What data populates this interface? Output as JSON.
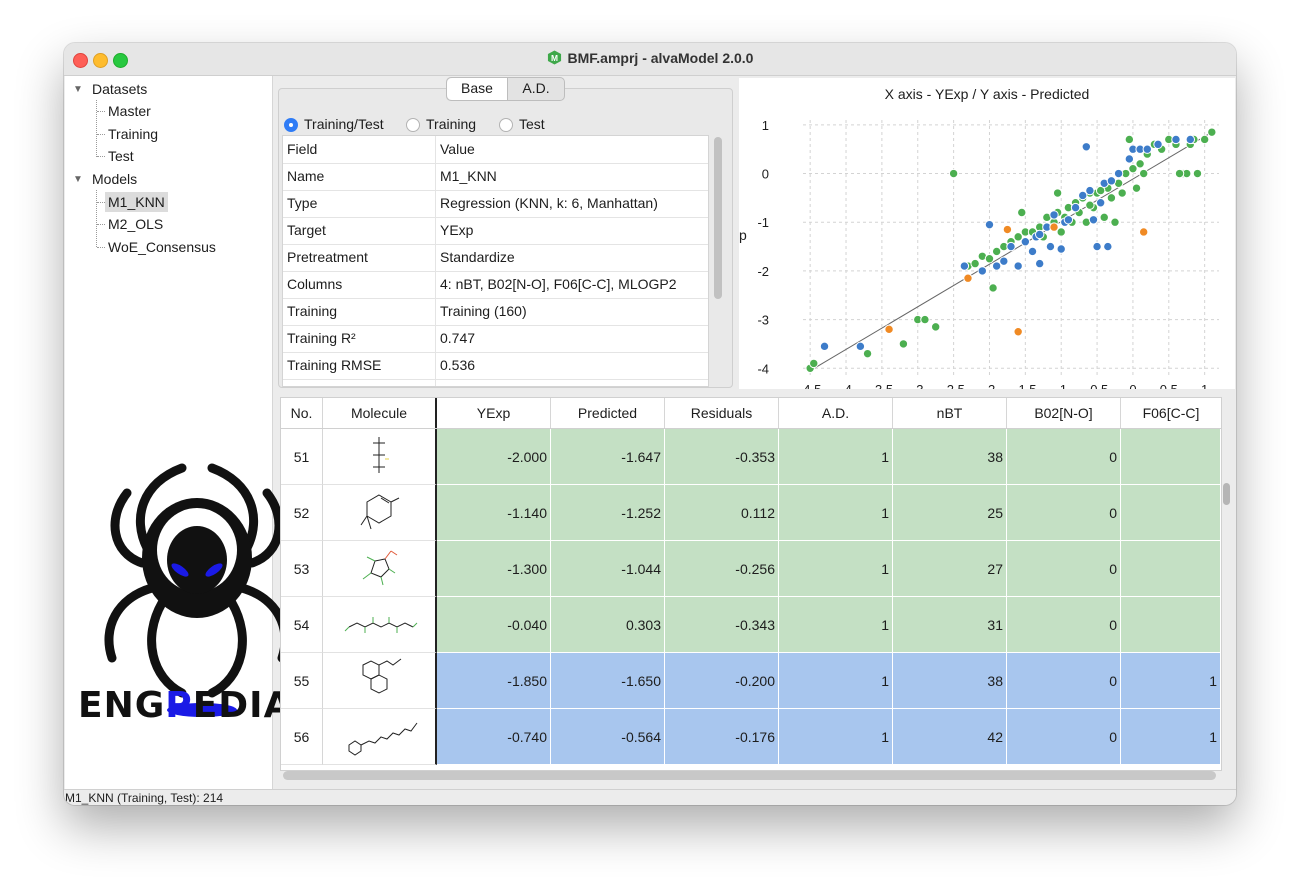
{
  "window": {
    "title": "BMF.amprj - alvaModel 2.0.0",
    "app_icon_letter": "M"
  },
  "tree": {
    "datasets": {
      "label": "Datasets",
      "children": [
        "Master",
        "Training",
        "Test"
      ]
    },
    "models": {
      "label": "Models",
      "children": [
        "M1_KNN",
        "M2_OLS",
        "WoE_Consensus"
      ],
      "selected": "M1_KNN"
    }
  },
  "logo": {
    "text": "ENGPEDIA.IR"
  },
  "tabs": {
    "base": "Base",
    "ad": "A.D.",
    "active": "Base"
  },
  "radios": {
    "training_test": "Training/Test",
    "training": "Training",
    "test": "Test",
    "selected": "Training/Test"
  },
  "properties": {
    "header": {
      "field": "Field",
      "value": "Value"
    },
    "rows": [
      {
        "field": "Name",
        "value": "M1_KNN"
      },
      {
        "field": "Type",
        "value": "Regression (KNN, k: 6, Manhattan)"
      },
      {
        "field": "Target",
        "value": "YExp"
      },
      {
        "field": "Pretreatment",
        "value": "Standardize"
      },
      {
        "field": "Columns",
        "value": "4: nBT, B02[N-O], F06[C-C], MLOGP2"
      },
      {
        "field": "Training",
        "value": "Training (160)"
      },
      {
        "field": "Training R²",
        "value": "0.747"
      },
      {
        "field": "Training RMSE",
        "value": "0.536"
      }
    ]
  },
  "chart_data": {
    "type": "scatter",
    "title": "X axis - YExp / Y axis - Predicted",
    "ylabel_partial": "p",
    "xlim": [
      -4.6,
      1.2
    ],
    "ylim": [
      -4.2,
      1.1
    ],
    "xticks": [
      -4.5,
      -4,
      -3.5,
      -3,
      -2.5,
      -2,
      -1.5,
      -1,
      -0.5,
      0,
      0.5,
      1
    ],
    "xtick_labels": [
      "-4.5",
      "-4",
      "-3.5",
      "-3",
      "-2.5",
      "-2",
      "-1.5",
      "-1",
      "-0.5",
      "0",
      "0.5",
      "1"
    ],
    "yticks": [
      1,
      0,
      -1,
      -2,
      -3,
      -4
    ],
    "ytick_labels": [
      "1-",
      "0-",
      "-1-",
      "-2-",
      "-3-",
      "-4-"
    ],
    "grid": true,
    "colors": {
      "green": "#4caf50",
      "blue": "#3d7cc9",
      "orange": "#f08a24",
      "line": "#666666"
    },
    "fit_line": {
      "x": [
        -4.5,
        1.1
      ],
      "y": [
        -4.05,
        0.85
      ]
    },
    "series": [
      {
        "color": "green",
        "points": [
          [
            -4.5,
            -4.0
          ],
          [
            -4.45,
            -3.9
          ],
          [
            -3.7,
            -3.7
          ],
          [
            -3.2,
            -3.5
          ],
          [
            -3.0,
            -3.0
          ],
          [
            -2.9,
            -3.0
          ],
          [
            -2.75,
            -3.15
          ],
          [
            -2.5,
            0.0
          ],
          [
            -2.3,
            -1.9
          ],
          [
            -2.2,
            -1.85
          ],
          [
            -2.1,
            -1.7
          ],
          [
            -2.0,
            -1.75
          ],
          [
            -1.95,
            -2.35
          ],
          [
            -1.9,
            -1.6
          ],
          [
            -1.8,
            -1.5
          ],
          [
            -1.7,
            -1.4
          ],
          [
            -1.6,
            -1.3
          ],
          [
            -1.5,
            -1.2
          ],
          [
            -1.4,
            -1.2
          ],
          [
            -1.3,
            -1.1
          ],
          [
            -1.25,
            -1.3
          ],
          [
            -1.2,
            -0.9
          ],
          [
            -1.1,
            -1.0
          ],
          [
            -1.05,
            -0.8
          ],
          [
            -1.0,
            -1.2
          ],
          [
            -0.95,
            -0.9
          ],
          [
            -0.9,
            -0.7
          ],
          [
            -0.85,
            -1.0
          ],
          [
            -0.8,
            -0.6
          ],
          [
            -0.75,
            -0.8
          ],
          [
            -0.7,
            -0.5
          ],
          [
            -0.65,
            -1.0
          ],
          [
            -0.6,
            -0.4
          ],
          [
            -0.55,
            -0.7
          ],
          [
            -0.5,
            -0.4
          ],
          [
            -0.4,
            -0.9
          ],
          [
            -0.35,
            -0.3
          ],
          [
            -0.3,
            -0.5
          ],
          [
            -0.25,
            -1.0
          ],
          [
            -0.2,
            -0.2
          ],
          [
            -0.15,
            -0.4
          ],
          [
            -0.1,
            0.0
          ],
          [
            -0.05,
            0.7
          ],
          [
            0.0,
            0.1
          ],
          [
            0.05,
            -0.3
          ],
          [
            0.1,
            0.2
          ],
          [
            0.2,
            0.4
          ],
          [
            0.3,
            0.6
          ],
          [
            0.4,
            0.5
          ],
          [
            0.5,
            0.7
          ],
          [
            0.6,
            0.6
          ],
          [
            0.7,
            0.0
          ],
          [
            0.75,
            0.0
          ],
          [
            0.8,
            0.6
          ],
          [
            0.85,
            0.7
          ],
          [
            0.9,
            0.0
          ],
          [
            1.0,
            0.7
          ],
          [
            1.1,
            0.85
          ],
          [
            0.15,
            0.0
          ],
          [
            0.65,
            0.0
          ],
          [
            -1.05,
            -0.4
          ],
          [
            -0.45,
            -0.35
          ],
          [
            -1.55,
            -0.8
          ],
          [
            -0.6,
            -0.65
          ]
        ]
      },
      {
        "color": "blue",
        "points": [
          [
            -3.8,
            -3.55
          ],
          [
            -4.3,
            -3.55
          ],
          [
            -2.35,
            -1.9
          ],
          [
            -2.1,
            -2.0
          ],
          [
            -2.0,
            -1.05
          ],
          [
            -1.9,
            -1.9
          ],
          [
            -1.8,
            -1.8
          ],
          [
            -1.7,
            -1.5
          ],
          [
            -1.6,
            -1.9
          ],
          [
            -1.5,
            -1.4
          ],
          [
            -1.4,
            -1.6
          ],
          [
            -1.35,
            -1.3
          ],
          [
            -1.3,
            -1.85
          ],
          [
            -1.2,
            -1.1
          ],
          [
            -1.15,
            -1.5
          ],
          [
            -1.1,
            -0.85
          ],
          [
            -1.0,
            -1.55
          ],
          [
            -0.95,
            -1.0
          ],
          [
            -0.9,
            -0.95
          ],
          [
            -0.8,
            -0.7
          ],
          [
            -0.7,
            -0.45
          ],
          [
            -0.6,
            -0.35
          ],
          [
            -0.55,
            -0.95
          ],
          [
            -0.5,
            -1.5
          ],
          [
            -0.4,
            -0.2
          ],
          [
            -0.35,
            -1.5
          ],
          [
            -0.3,
            -0.15
          ],
          [
            -0.2,
            0.0
          ],
          [
            -0.05,
            0.3
          ],
          [
            0.0,
            0.5
          ],
          [
            0.1,
            0.5
          ],
          [
            0.2,
            0.5
          ],
          [
            0.35,
            0.6
          ],
          [
            0.6,
            0.7
          ],
          [
            0.8,
            0.7
          ],
          [
            -0.65,
            0.55
          ],
          [
            -1.3,
            -1.25
          ],
          [
            -0.45,
            -0.6
          ]
        ]
      },
      {
        "color": "orange",
        "points": [
          [
            -2.3,
            -2.15
          ],
          [
            -3.4,
            -3.2
          ],
          [
            -1.75,
            -1.15
          ],
          [
            -1.6,
            -3.25
          ],
          [
            0.15,
            -1.2
          ],
          [
            -1.1,
            -1.1
          ]
        ]
      }
    ]
  },
  "table": {
    "columns": [
      "No.",
      "Molecule",
      "YExp",
      "Predicted",
      "Residuals",
      "A.D.",
      "nBT",
      "B02[N-O]",
      "F06[C-C]"
    ],
    "rows": [
      {
        "no": "51",
        "yexp": "-2.000",
        "pred": "-1.647",
        "resid": "-0.353",
        "ad": "1",
        "nbt": "38",
        "b02": "0",
        "f06": "",
        "set": "training"
      },
      {
        "no": "52",
        "yexp": "-1.140",
        "pred": "-1.252",
        "resid": "0.112",
        "ad": "1",
        "nbt": "25",
        "b02": "0",
        "f06": "",
        "set": "training"
      },
      {
        "no": "53",
        "yexp": "-1.300",
        "pred": "-1.044",
        "resid": "-0.256",
        "ad": "1",
        "nbt": "27",
        "b02": "0",
        "f06": "",
        "set": "training"
      },
      {
        "no": "54",
        "yexp": "-0.040",
        "pred": "0.303",
        "resid": "-0.343",
        "ad": "1",
        "nbt": "31",
        "b02": "0",
        "f06": "",
        "set": "training"
      },
      {
        "no": "55",
        "yexp": "-1.850",
        "pred": "-1.650",
        "resid": "-0.200",
        "ad": "1",
        "nbt": "38",
        "b02": "0",
        "f06": "1",
        "set": "test"
      },
      {
        "no": "56",
        "yexp": "-0.740",
        "pred": "-0.564",
        "resid": "-0.176",
        "ad": "1",
        "nbt": "42",
        "b02": "0",
        "f06": "1",
        "set": "test"
      }
    ]
  },
  "status": {
    "text": "M1_KNN (Training, Test): 214"
  }
}
